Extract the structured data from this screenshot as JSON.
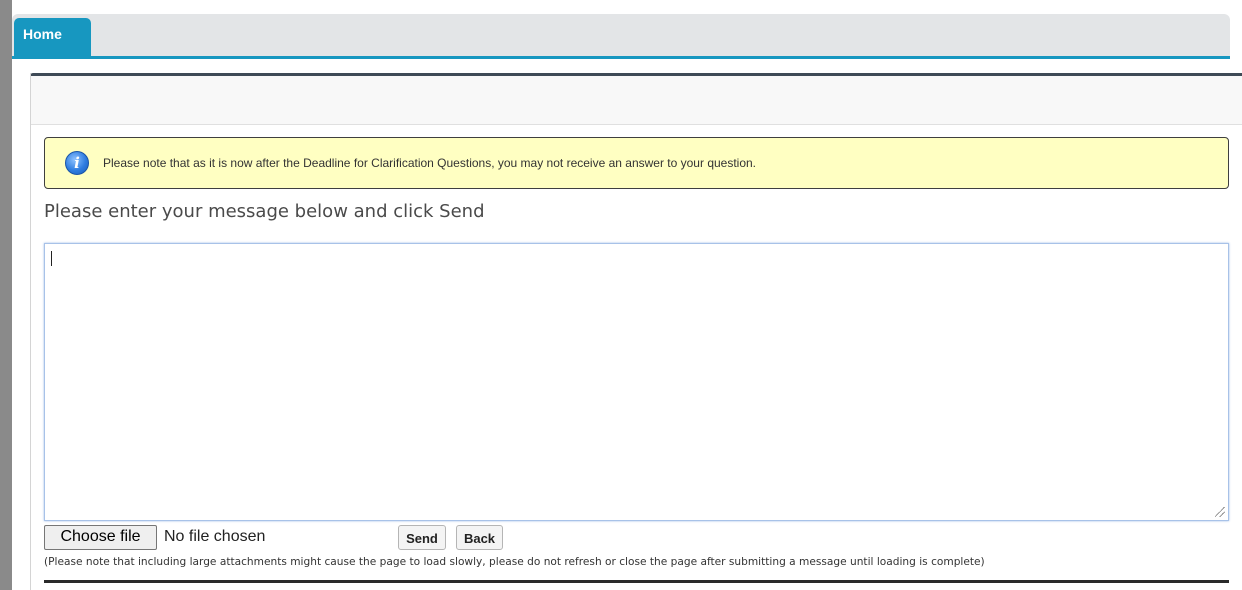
{
  "tabs": [
    {
      "label": "Home",
      "active": true
    }
  ],
  "notice": {
    "icon": "info-icon",
    "icon_glyph": "i",
    "text": "Please note that as it is now after the Deadline for Clarification Questions, you may not receive an answer to your question."
  },
  "form": {
    "instruction": "Please enter your message below and click Send",
    "message_value": "",
    "file_button_label": "Choose file",
    "file_status": "No file chosen",
    "send_label": "Send",
    "back_label": "Back",
    "attachment_note": "(Please note that including large attachments might cause the page to load slowly, please do not refresh or close the page after submitting a message until loading is complete)"
  },
  "colors": {
    "accent": "#1797c0",
    "notice_bg": "#ffffc2"
  }
}
